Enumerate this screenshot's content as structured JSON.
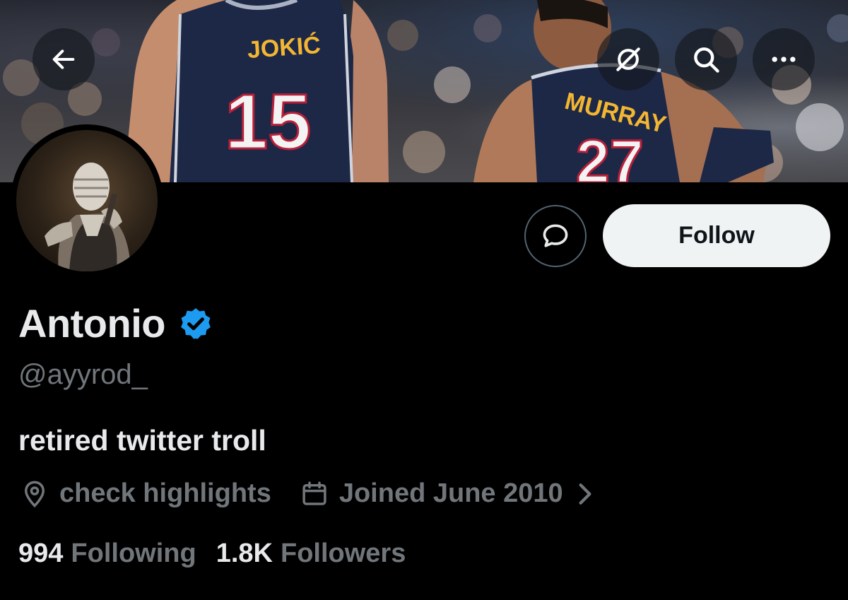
{
  "banner": {
    "jersey_left_name": "JOKIĆ",
    "jersey_left_number": "15",
    "jersey_right_name": "MURRAY",
    "jersey_right_number": "27"
  },
  "top_bar": {
    "back_icon": "arrow-left-icon",
    "grok_icon": "slashed-circle-icon",
    "search_icon": "search-icon",
    "more_icon": "ellipsis-icon"
  },
  "actions": {
    "message_icon": "message-bubble-icon",
    "follow_label": "Follow"
  },
  "profile": {
    "display_name": "Antonio",
    "verified_icon": "verified-badge-icon",
    "handle": "@ayyrod_",
    "bio": "retired twitter troll",
    "location": "check highlights",
    "joined": "Joined June 2010",
    "following_count": "994",
    "following_label": "Following",
    "followers_count": "1.8K",
    "followers_label": "Followers"
  },
  "colors": {
    "background": "#000000",
    "primary_text": "#e7e9ea",
    "secondary_text": "#71767b",
    "verified_blue": "#1d9bf0",
    "follow_button_bg": "#eff3f4",
    "jersey_navy": "#1d2847",
    "jersey_gold": "#f2b632"
  }
}
